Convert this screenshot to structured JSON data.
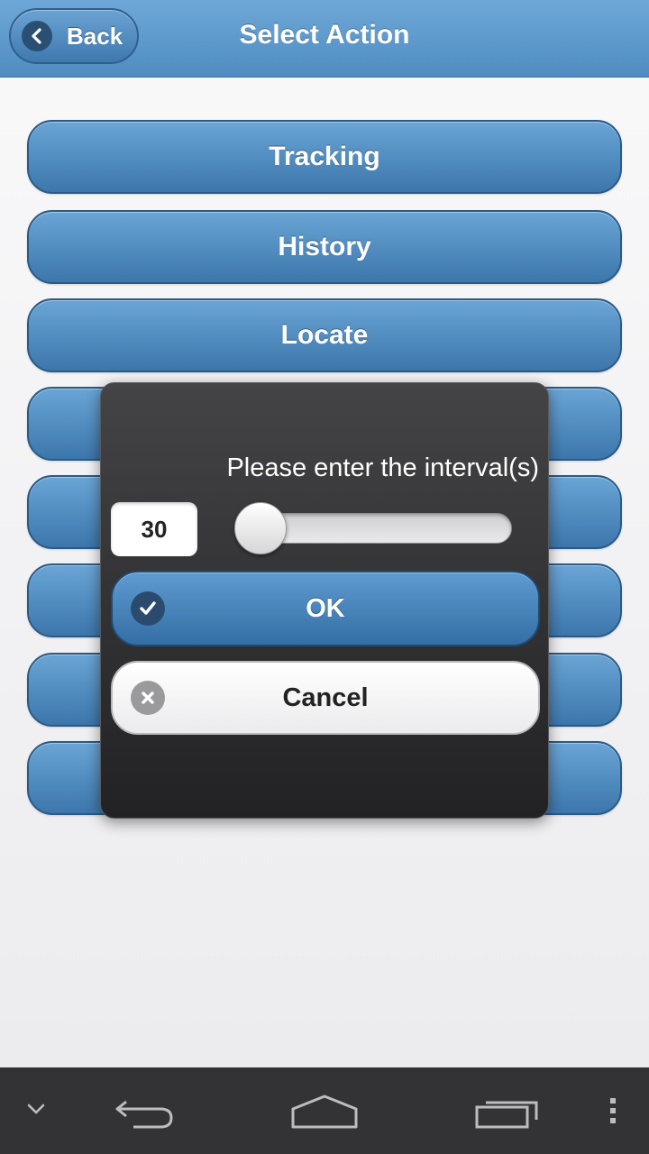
{
  "header": {
    "back_label": "Back",
    "title": "Select Action"
  },
  "actions": [
    {
      "label": "Tracking"
    },
    {
      "label": "History"
    },
    {
      "label": "Locate"
    },
    {
      "label": ""
    },
    {
      "label": ""
    },
    {
      "label": ""
    },
    {
      "label": ""
    },
    {
      "label": ""
    }
  ],
  "dialog": {
    "prompt": "Please enter the interval(s)",
    "interval_value": "30",
    "ok_label": "OK",
    "cancel_label": "Cancel"
  },
  "icons": {
    "back": "chevron-left-icon",
    "ok": "check-icon",
    "cancel": "x-icon",
    "nav": [
      "chevron-down-icon",
      "back-arrow-icon",
      "home-icon",
      "recent-apps-icon",
      "overflow-menu-icon"
    ]
  },
  "colors": {
    "header": "#5b98cc",
    "button_blue": "#4f8cc1",
    "dialog_bg": "#333335",
    "navbar": "#333335"
  }
}
